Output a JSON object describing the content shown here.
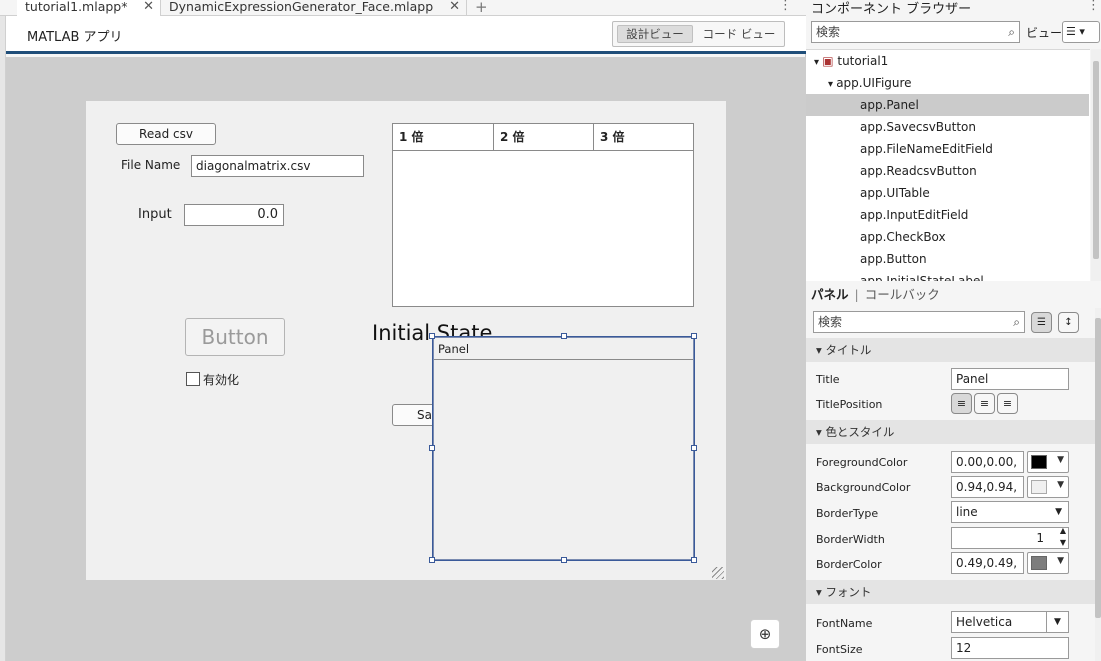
{
  "tabs": [
    {
      "label": "tutorial1.mlapp*",
      "active": true
    },
    {
      "label": "DynamicExpressionGenerator_Face.mlapp",
      "active": false
    }
  ],
  "appbar": {
    "title": "MATLAB アプリ",
    "design_view": "設計ビュー",
    "code_view": "コード ビュー"
  },
  "figure": {
    "read_button": "Read csv",
    "filename_label": "File Name",
    "filename_value": "diagonalmatrix.csv",
    "input_label": "Input",
    "input_value": "0.0",
    "button_label": "Button",
    "checkbox_label": "有効化",
    "table_headers": [
      "1 倍",
      "2 倍",
      "3 倍"
    ],
    "initial_state": "Initial State",
    "save_button_partial": "Sa",
    "panel_title": "Panel"
  },
  "browser": {
    "title": "コンポーネント ブラウザー",
    "search_placeholder": "検索",
    "view_label": "ビュー:",
    "tree": [
      {
        "label": "tutorial1",
        "level": 0
      },
      {
        "label": "app.UIFigure",
        "level": 1
      },
      {
        "label": "app.Panel",
        "level": 2,
        "selected": true
      },
      {
        "label": "app.SavecsvButton",
        "level": 2
      },
      {
        "label": "app.FileNameEditField",
        "level": 2
      },
      {
        "label": "app.ReadcsvButton",
        "level": 2
      },
      {
        "label": "app.UITable",
        "level": 2
      },
      {
        "label": "app.InputEditField",
        "level": 2
      },
      {
        "label": "app.CheckBox",
        "level": 2
      },
      {
        "label": "app.Button",
        "level": 2
      },
      {
        "label": "app.InitialStateLabel",
        "level": 2
      }
    ]
  },
  "inspector": {
    "tab_panel": "パネル",
    "tab_callback": "コールバック",
    "search_placeholder": "検索",
    "sections": {
      "title": "タイトル",
      "color_style": "色とスタイル",
      "font": "フォント"
    },
    "props": {
      "title_label": "Title",
      "title_value": "Panel",
      "titlepos_label": "TitlePosition",
      "fg_label": "ForegroundColor",
      "fg_value": "0.00,0.00,",
      "fg_color": "#000000",
      "bg_label": "BackgroundColor",
      "bg_value": "0.94,0.94,",
      "bg_color": "#f0f0f0",
      "bordertype_label": "BorderType",
      "bordertype_value": "line",
      "borderwidth_label": "BorderWidth",
      "borderwidth_value": "1",
      "bordercolor_label": "BorderColor",
      "bordercolor_value": "0.49,0.49,",
      "bordercolor_color": "#7d7d7d",
      "fontname_label": "FontName",
      "fontname_value": "Helvetica",
      "fontsize_label": "FontSize",
      "fontsize_value": "12"
    }
  }
}
